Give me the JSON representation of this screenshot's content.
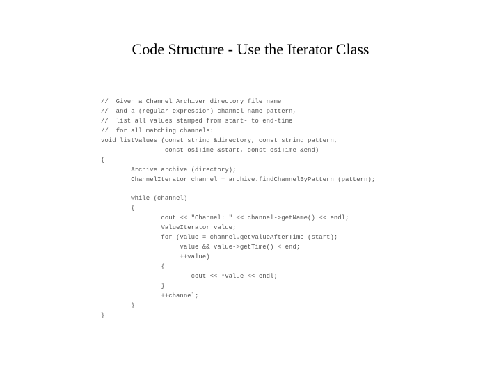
{
  "title": "Code Structure - Use the Iterator Class",
  "code": "//  Given a Channel Archiver directory file name\n//  and a (regular expression) channel name pattern,\n//  list all values stamped from start- to end-time\n//  for all matching channels:\nvoid listValues (const string &directory, const string pattern,\n                 const osiTime &start, const osiTime &end)\n{\n        Archive archive (directory);\n        ChannelIterator channel = archive.findChannelByPattern (pattern);\n\n        while (channel)\n        {\n                cout << \"Channel: \" << channel->getName() << endl;\n                ValueIterator value;\n                for (value = channel.getValueAfterTime (start);\n                     value && value->getTime() < end;\n                     ++value)\n                {\n                        cout << *value << endl;\n                }\n                ++channel;\n        }\n}"
}
